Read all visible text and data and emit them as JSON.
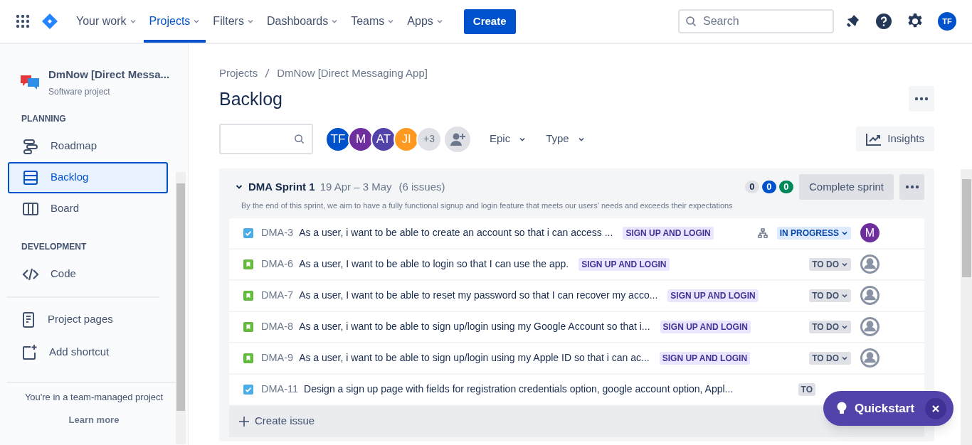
{
  "nav": {
    "items": [
      {
        "label": "Your work",
        "selected": false
      },
      {
        "label": "Projects",
        "selected": true
      },
      {
        "label": "Filters",
        "selected": false
      },
      {
        "label": "Dashboards",
        "selected": false
      },
      {
        "label": "Teams",
        "selected": false
      },
      {
        "label": "Apps",
        "selected": false
      }
    ],
    "create": "Create",
    "search": {
      "placeholder": "Search"
    },
    "user_initials": "TF"
  },
  "sidebar": {
    "project_name": "DmNow [Direct Messa...",
    "project_type": "Software project",
    "sections": [
      {
        "title": "PLANNING",
        "items": [
          {
            "label": "Roadmap",
            "selected": false
          },
          {
            "label": "Backlog",
            "selected": true
          },
          {
            "label": "Board",
            "selected": false
          }
        ]
      },
      {
        "title": "DEVELOPMENT",
        "items": [
          {
            "label": "Code",
            "selected": false
          }
        ]
      }
    ],
    "links": [
      "Project pages",
      "Add shortcut"
    ],
    "footer": "You're in a team-managed project",
    "learn_more": "Learn more"
  },
  "breadcrumbs": [
    "Projects",
    "DmNow [Direct Messaging App]"
  ],
  "title": "Backlog",
  "avatars": [
    {
      "initials": "TF",
      "color": "#0052cc"
    },
    {
      "initials": "M",
      "color": "#6e2e9e"
    },
    {
      "initials": "AT",
      "color": "#5243aa"
    },
    {
      "initials": "JI",
      "color": "#ff991f"
    }
  ],
  "more_avatars": "+3",
  "filters": [
    "Epic",
    "Type"
  ],
  "insights": "Insights",
  "sprint": {
    "name": "DMA Sprint 1",
    "dates": "19 Apr – 3 May",
    "count": "(6 issues)",
    "goal": "By the end of this sprint, we aim to have a fully functional signup and login feature that meets our users' needs and exceeds their expectations",
    "counters": [
      {
        "value": "0",
        "color": "#dfe1e6"
      },
      {
        "value": "0",
        "color": "#0052cc"
      },
      {
        "value": "0",
        "color": "#00875a"
      }
    ],
    "complete": "Complete sprint",
    "issues": [
      {
        "kind": "task",
        "key": "DMA-3",
        "summary": "As a user, i want to be able to create an account so that i can access ...",
        "epic": "SIGN UP AND LOGIN",
        "has_children": true,
        "status": {
          "label": "IN PROGRESS",
          "kind": "progress"
        },
        "assignee": "M"
      },
      {
        "kind": "story",
        "key": "DMA-6",
        "summary": "As a user, I want to be able to login so that I can use the app.",
        "epic": "SIGN UP AND LOGIN",
        "has_children": false,
        "status": {
          "label": "TO DO",
          "kind": "todo"
        }
      },
      {
        "kind": "story",
        "key": "DMA-7",
        "summary": "As a user, I want to be able to reset my password so that I can recover my acco...",
        "epic": "SIGN UP AND LOGIN",
        "has_children": false,
        "status": {
          "label": "TO DO",
          "kind": "todo"
        }
      },
      {
        "kind": "story",
        "key": "DMA-8",
        "summary": "As a user, i want to be able to sign up/login using my Google Account so that i...",
        "epic": "SIGN UP AND LOGIN",
        "has_children": false,
        "status": {
          "label": "TO DO",
          "kind": "todo"
        }
      },
      {
        "kind": "story",
        "key": "DMA-9",
        "summary": "As a user, i want to be able to sign up/login using my Apple ID so that i can ac...",
        "epic": "SIGN UP AND LOGIN",
        "has_children": false,
        "status": {
          "label": "TO DO",
          "kind": "todo"
        }
      },
      {
        "kind": "task",
        "key": "DMA-11",
        "summary": "Design a sign up page with fields for registration credentials option, google account option, Appl...",
        "has_children": false,
        "status": {
          "label": "TO",
          "kind": "partial"
        }
      }
    ],
    "create_issue": "Create issue"
  },
  "quickstart": "Quickstart"
}
